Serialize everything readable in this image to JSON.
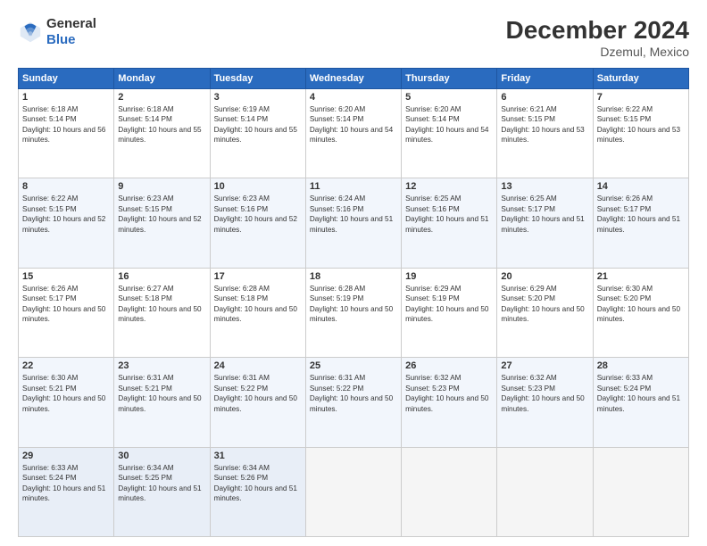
{
  "header": {
    "logo_line1": "General",
    "logo_line2": "Blue",
    "title": "December 2024",
    "subtitle": "Dzemul, Mexico"
  },
  "calendar": {
    "days_of_week": [
      "Sunday",
      "Monday",
      "Tuesday",
      "Wednesday",
      "Thursday",
      "Friday",
      "Saturday"
    ],
    "weeks": [
      [
        null,
        null,
        {
          "day": "3",
          "sunrise": "6:19 AM",
          "sunset": "5:14 PM",
          "daylight": "10 hours and 55 minutes."
        },
        {
          "day": "4",
          "sunrise": "6:20 AM",
          "sunset": "5:14 PM",
          "daylight": "10 hours and 54 minutes."
        },
        {
          "day": "5",
          "sunrise": "6:20 AM",
          "sunset": "5:14 PM",
          "daylight": "10 hours and 54 minutes."
        },
        {
          "day": "6",
          "sunrise": "6:21 AM",
          "sunset": "5:15 PM",
          "daylight": "10 hours and 53 minutes."
        },
        {
          "day": "7",
          "sunrise": "6:22 AM",
          "sunset": "5:15 PM",
          "daylight": "10 hours and 53 minutes."
        }
      ],
      [
        {
          "day": "1",
          "sunrise": "6:18 AM",
          "sunset": "5:14 PM",
          "daylight": "10 hours and 56 minutes."
        },
        {
          "day": "2",
          "sunrise": "6:18 AM",
          "sunset": "5:14 PM",
          "daylight": "10 hours and 55 minutes."
        },
        null,
        null,
        null,
        null,
        null
      ],
      [
        {
          "day": "8",
          "sunrise": "6:22 AM",
          "sunset": "5:15 PM",
          "daylight": "10 hours and 52 minutes."
        },
        {
          "day": "9",
          "sunrise": "6:23 AM",
          "sunset": "5:15 PM",
          "daylight": "10 hours and 52 minutes."
        },
        {
          "day": "10",
          "sunrise": "6:23 AM",
          "sunset": "5:16 PM",
          "daylight": "10 hours and 52 minutes."
        },
        {
          "day": "11",
          "sunrise": "6:24 AM",
          "sunset": "5:16 PM",
          "daylight": "10 hours and 51 minutes."
        },
        {
          "day": "12",
          "sunrise": "6:25 AM",
          "sunset": "5:16 PM",
          "daylight": "10 hours and 51 minutes."
        },
        {
          "day": "13",
          "sunrise": "6:25 AM",
          "sunset": "5:17 PM",
          "daylight": "10 hours and 51 minutes."
        },
        {
          "day": "14",
          "sunrise": "6:26 AM",
          "sunset": "5:17 PM",
          "daylight": "10 hours and 51 minutes."
        }
      ],
      [
        {
          "day": "15",
          "sunrise": "6:26 AM",
          "sunset": "5:17 PM",
          "daylight": "10 hours and 50 minutes."
        },
        {
          "day": "16",
          "sunrise": "6:27 AM",
          "sunset": "5:18 PM",
          "daylight": "10 hours and 50 minutes."
        },
        {
          "day": "17",
          "sunrise": "6:28 AM",
          "sunset": "5:18 PM",
          "daylight": "10 hours and 50 minutes."
        },
        {
          "day": "18",
          "sunrise": "6:28 AM",
          "sunset": "5:19 PM",
          "daylight": "10 hours and 50 minutes."
        },
        {
          "day": "19",
          "sunrise": "6:29 AM",
          "sunset": "5:19 PM",
          "daylight": "10 hours and 50 minutes."
        },
        {
          "day": "20",
          "sunrise": "6:29 AM",
          "sunset": "5:20 PM",
          "daylight": "10 hours and 50 minutes."
        },
        {
          "day": "21",
          "sunrise": "6:30 AM",
          "sunset": "5:20 PM",
          "daylight": "10 hours and 50 minutes."
        }
      ],
      [
        {
          "day": "22",
          "sunrise": "6:30 AM",
          "sunset": "5:21 PM",
          "daylight": "10 hours and 50 minutes."
        },
        {
          "day": "23",
          "sunrise": "6:31 AM",
          "sunset": "5:21 PM",
          "daylight": "10 hours and 50 minutes."
        },
        {
          "day": "24",
          "sunrise": "6:31 AM",
          "sunset": "5:22 PM",
          "daylight": "10 hours and 50 minutes."
        },
        {
          "day": "25",
          "sunrise": "6:31 AM",
          "sunset": "5:22 PM",
          "daylight": "10 hours and 50 minutes."
        },
        {
          "day": "26",
          "sunrise": "6:32 AM",
          "sunset": "5:23 PM",
          "daylight": "10 hours and 50 minutes."
        },
        {
          "day": "27",
          "sunrise": "6:32 AM",
          "sunset": "5:23 PM",
          "daylight": "10 hours and 50 minutes."
        },
        {
          "day": "28",
          "sunrise": "6:33 AM",
          "sunset": "5:24 PM",
          "daylight": "10 hours and 51 minutes."
        }
      ],
      [
        {
          "day": "29",
          "sunrise": "6:33 AM",
          "sunset": "5:24 PM",
          "daylight": "10 hours and 51 minutes."
        },
        {
          "day": "30",
          "sunrise": "6:34 AM",
          "sunset": "5:25 PM",
          "daylight": "10 hours and 51 minutes."
        },
        {
          "day": "31",
          "sunrise": "6:34 AM",
          "sunset": "5:26 PM",
          "daylight": "10 hours and 51 minutes."
        },
        null,
        null,
        null,
        null
      ]
    ]
  }
}
